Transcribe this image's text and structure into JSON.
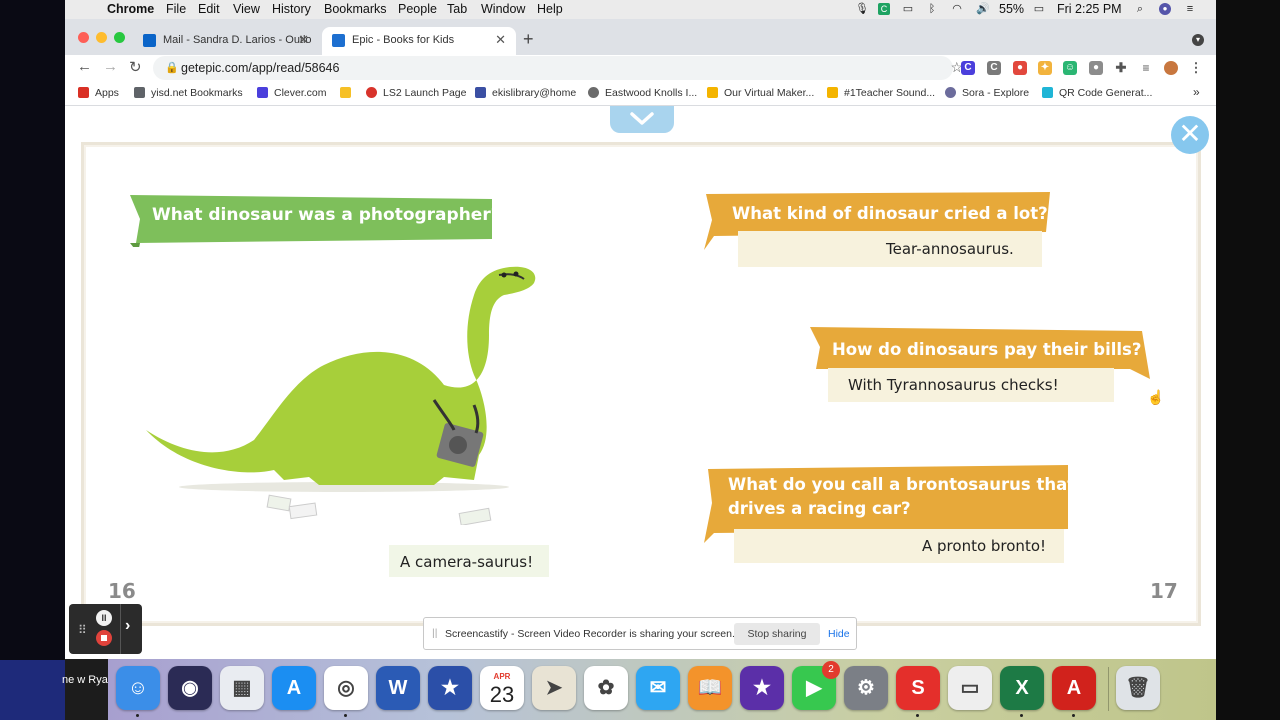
{
  "menubar": {
    "app": "Chrome",
    "items": [
      "File",
      "Edit",
      "View",
      "History",
      "Bookmarks",
      "People",
      "Tab",
      "Window",
      "Help"
    ],
    "battery": "55%",
    "clock": "Fri 2:25 PM"
  },
  "tabs": [
    {
      "title": "Mail - Sandra D. Larios - Outlo",
      "icon_color": "#0a64c8"
    },
    {
      "title": "Epic - Books for Kids",
      "icon_color": "#1d6fd0"
    }
  ],
  "address": {
    "url": "getepic.com/app/read/58646"
  },
  "bookmarks": [
    {
      "label": "Apps",
      "color": "#d93025"
    },
    {
      "label": "yisd.net Bookmarks",
      "color": "#5f6368"
    },
    {
      "label": "Clever.com",
      "color": "#4b3fdc"
    },
    {
      "label": "",
      "color": "#f6c026"
    },
    {
      "label": "LS2 Launch Page",
      "color": "#d8332b"
    },
    {
      "label": "ekislibrary@home",
      "color": "#3b4fa3"
    },
    {
      "label": "Eastwood Knolls I...",
      "color": "#6b6b6b"
    },
    {
      "label": "Our Virtual Maker...",
      "color": "#f4b400"
    },
    {
      "label": "#1Teacher Sound...",
      "color": "#f4b400"
    },
    {
      "label": "Sora - Explore",
      "color": "#6c6c9c"
    },
    {
      "label": "QR Code Generat...",
      "color": "#1fb5d6"
    }
  ],
  "book": {
    "left": {
      "question": "What dinosaur was a photographer?",
      "answer": "A camera-saurus!",
      "page_number": "16"
    },
    "right": [
      {
        "question": "What kind of dinosaur cried a lot?",
        "answer": "Tear-annosaurus."
      },
      {
        "question": "How do dinosaurs pay their bills?",
        "answer": "With Tyrannosaurus checks!"
      },
      {
        "question_line1": "What do you call a brontosaurus that",
        "question_line2": "drives a racing car?",
        "answer": "A pronto bronto!"
      }
    ],
    "right_page_number": "17",
    "colors": {
      "green_banner": "#7ebf5b",
      "gold_banner": "#e7a93a",
      "answer_bg": "#f7f2dd"
    }
  },
  "screencastify": {
    "message": "Screencastify - Screen Video Recorder is sharing your screen.",
    "stop_label": "Stop sharing",
    "hide_label": "Hide"
  },
  "leftstrip_text": "ne w Rya",
  "dock": {
    "apps": [
      {
        "name": "Finder",
        "color": "#3b8ee8"
      },
      {
        "name": "Siri",
        "color": "#2b2b55"
      },
      {
        "name": "Keynote",
        "color": "#e9ecf1"
      },
      {
        "name": "App Store",
        "color": "#1b8ef2"
      },
      {
        "name": "Chrome",
        "color": "#ffffff"
      },
      {
        "name": "Word",
        "color": "#2b5bb5"
      },
      {
        "name": "Texas",
        "color": "#2b4fa8"
      },
      {
        "name": "Calendar",
        "color": "#ffffff"
      },
      {
        "name": "Maps",
        "color": "#e8e3d4"
      },
      {
        "name": "Photos",
        "color": "#ffffff"
      },
      {
        "name": "Messages",
        "color": "#2ea6f2"
      },
      {
        "name": "Books",
        "color": "#f3932b"
      },
      {
        "name": "iMovie",
        "color": "#5b2fa8"
      },
      {
        "name": "FaceTime",
        "color": "#37c84f"
      },
      {
        "name": "System Preferences",
        "color": "#7b7f86"
      },
      {
        "name": "Screencastify",
        "color": "#e42f2b"
      },
      {
        "name": "Preview",
        "color": "#eeeeee"
      },
      {
        "name": "Excel",
        "color": "#1d7a45"
      },
      {
        "name": "Acrobat",
        "color": "#d1221c"
      },
      {
        "name": "Trash",
        "color": "#dfe3e7"
      }
    ],
    "calendar_month": "APR",
    "calendar_day": "23",
    "facetime_badge": "2"
  }
}
